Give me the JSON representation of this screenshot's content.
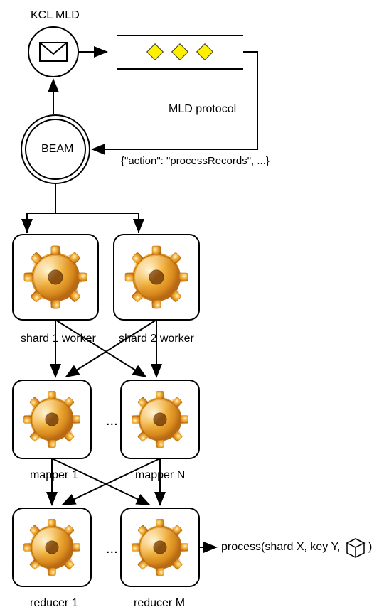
{
  "title": "KCL MLD",
  "beam_label": "BEAM",
  "protocol_label": "MLD protocol",
  "action_json": "{\"action\": \"processRecords\", ...}",
  "shard1_label": "shard 1 worker",
  "shard2_label": "shard 2 worker",
  "mapper1_label": "mapper 1",
  "mapperN_label": "mapper N",
  "reducer1_label": "reducer 1",
  "reducerM_label": "reducer M",
  "process_call": "process(shard X, key Y,",
  "process_close": ")"
}
